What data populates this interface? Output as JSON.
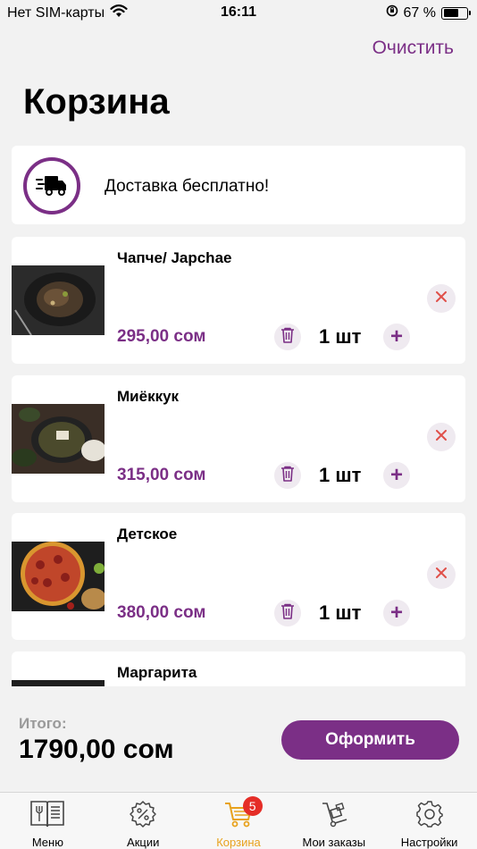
{
  "status_bar": {
    "carrier": "Нет SIM-карты",
    "time": "16:11",
    "battery_text": "67 %",
    "battery_level": 0.67
  },
  "header": {
    "clear_label": "Очистить",
    "title": "Корзина"
  },
  "delivery": {
    "text": "Доставка бесплатно!"
  },
  "products": [
    {
      "name": "Чапче/ Japchae",
      "price": "295,00 сом",
      "qty": "1 шт"
    },
    {
      "name": "Миёккук",
      "price": "315,00 сом",
      "qty": "1 шт"
    },
    {
      "name": "Детское",
      "price": "380,00 сом",
      "qty": "1 шт"
    },
    {
      "name": "Маргарита",
      "price": "",
      "qty": ""
    }
  ],
  "footer": {
    "total_label": "Итого:",
    "total_value": "1790,00 сом",
    "checkout_label": "Оформить"
  },
  "tabs": [
    {
      "label": "Меню",
      "icon": "menu-book-icon"
    },
    {
      "label": "Акции",
      "icon": "discount-gear-icon"
    },
    {
      "label": "Корзина",
      "icon": "cart-icon",
      "badge": "5",
      "active": true
    },
    {
      "label": "Мои заказы",
      "icon": "hand-truck-icon"
    },
    {
      "label": "Настройки",
      "icon": "settings-gear-icon"
    }
  ],
  "colors": {
    "accent": "#7b2f86",
    "active_tab": "#e8a21d",
    "badge": "#e52d27",
    "remove_x": "#e0504a"
  }
}
